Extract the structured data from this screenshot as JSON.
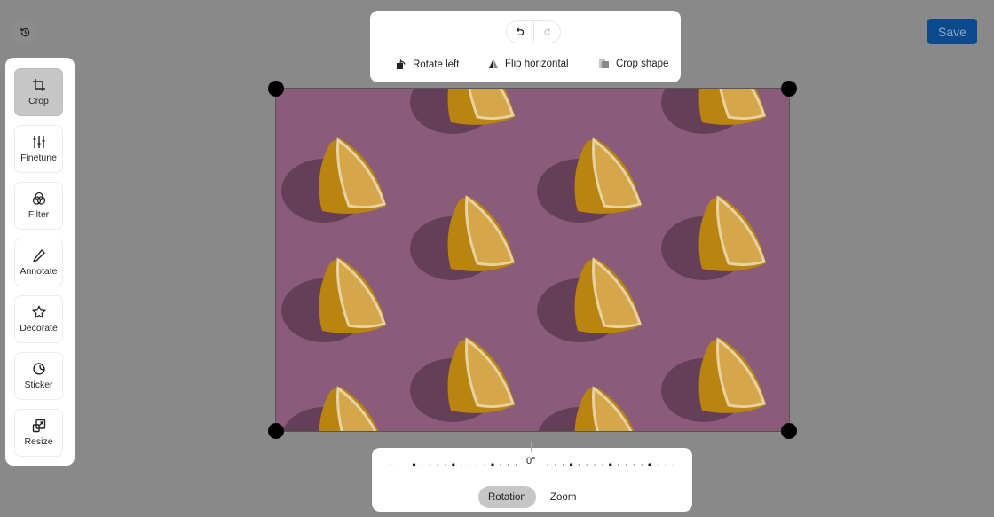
{
  "header": {
    "history_icon": "history-icon",
    "save_label": "Save",
    "save_color": "#0b4a8f"
  },
  "sidebar": {
    "items": [
      {
        "label": "Crop",
        "icon": "crop-icon",
        "active": true
      },
      {
        "label": "Finetune",
        "icon": "sliders-icon",
        "active": false
      },
      {
        "label": "Filter",
        "icon": "filter-circles-icon",
        "active": false
      },
      {
        "label": "Annotate",
        "icon": "pencil-icon",
        "active": false
      },
      {
        "label": "Decorate",
        "icon": "star-icon",
        "active": false
      },
      {
        "label": "Sticker",
        "icon": "sticker-icon",
        "active": false
      },
      {
        "label": "Resize",
        "icon": "resize-icon",
        "active": false
      }
    ]
  },
  "toolbar": {
    "undo_icon": "undo-icon",
    "redo_icon": "redo-icon",
    "rotate_left_label": "Rotate left",
    "flip_horizontal_label": "Flip horizontal",
    "crop_shape_label": "Crop shape"
  },
  "canvas": {
    "image_description": "Lemon halves on pink background",
    "background_color": "#8a5c7a"
  },
  "bottom": {
    "rotation_value": "0°",
    "tabs": [
      {
        "label": "Rotation",
        "active": true
      },
      {
        "label": "Zoom",
        "active": false
      }
    ]
  }
}
